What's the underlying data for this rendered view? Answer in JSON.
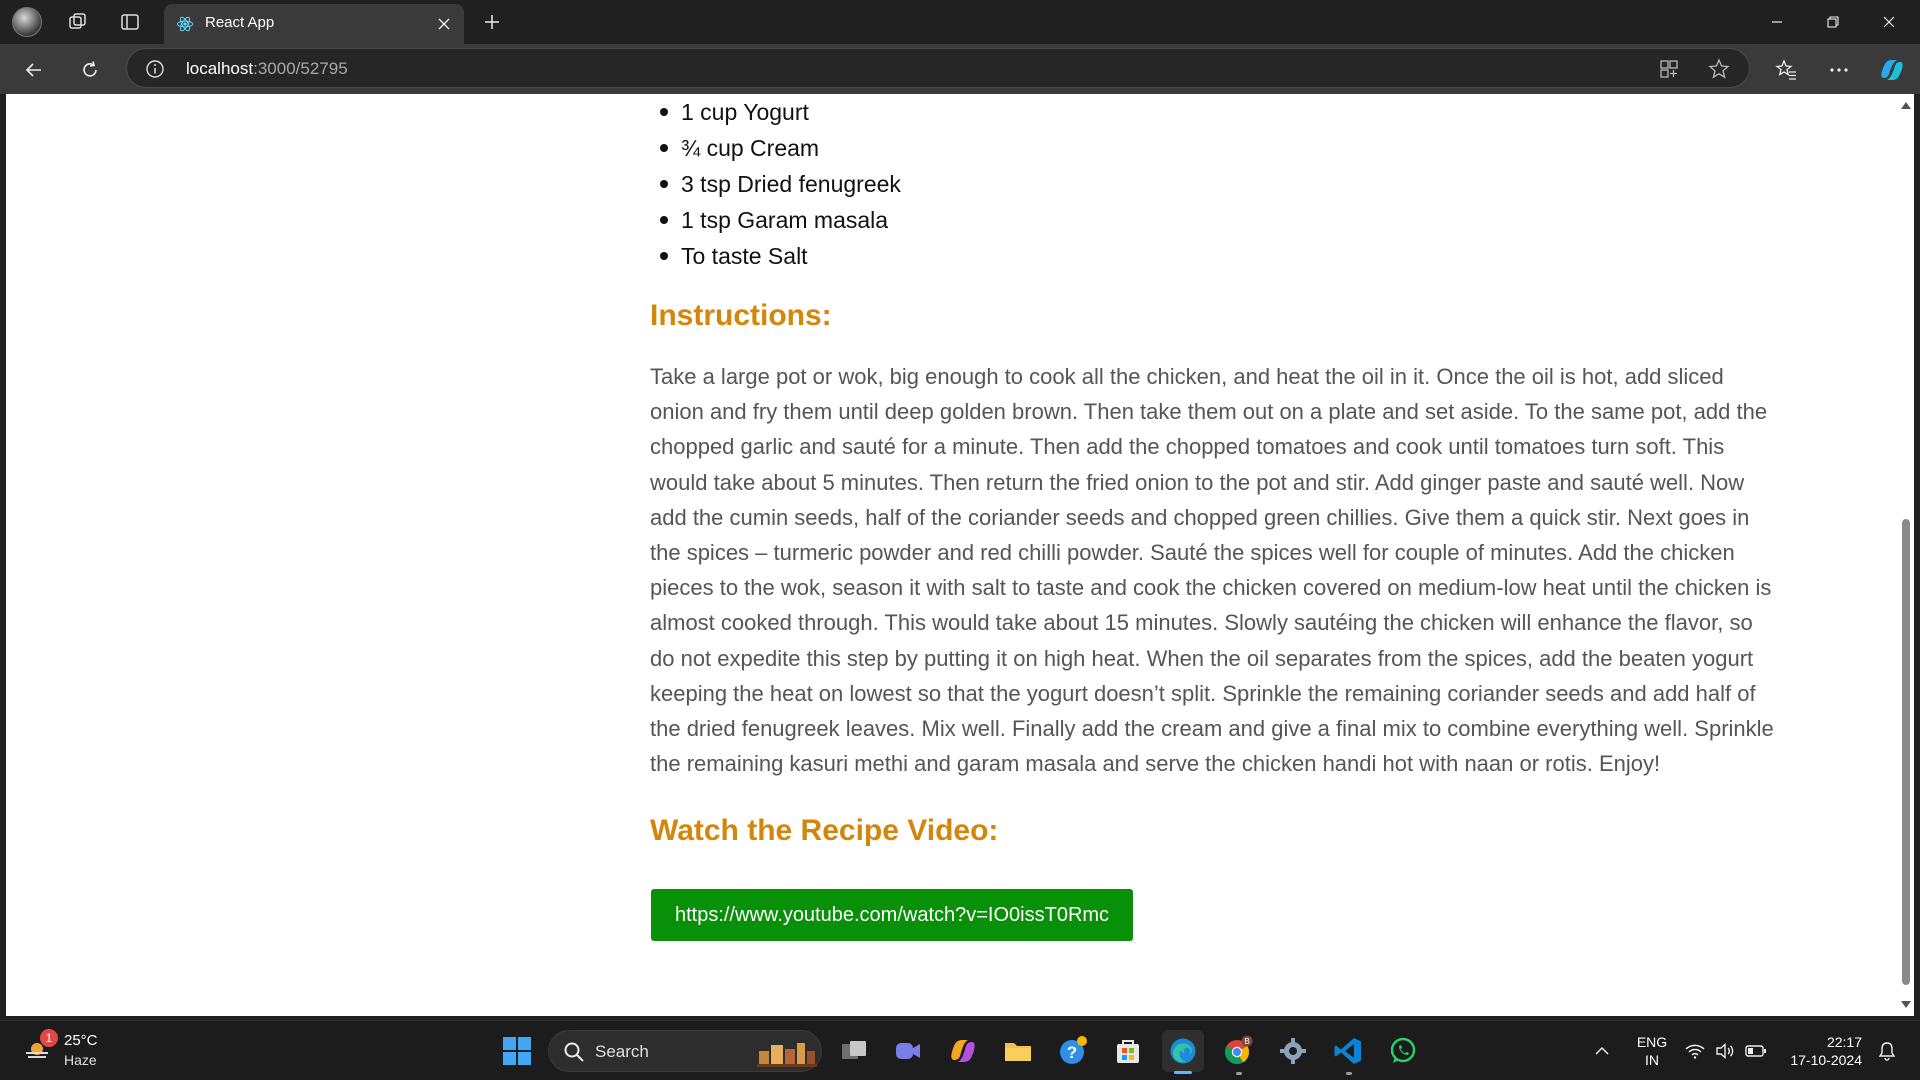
{
  "browser": {
    "tab": {
      "title": "React App"
    },
    "address": {
      "host": "localhost",
      "path": ":3000/52795"
    }
  },
  "page": {
    "ingredients": [
      "1 cup Yogurt",
      "¾ cup Cream",
      "3 tsp Dried fenugreek",
      "1 tsp Garam masala",
      "To taste Salt"
    ],
    "instructions_heading": "Instructions:",
    "instructions_text": "Take a large pot or wok, big enough to cook all the chicken, and heat the oil in it. Once the oil is hot, add sliced onion and fry them until deep golden brown. Then take them out on a plate and set aside. To the same pot, add the chopped garlic and sauté for a minute. Then add the chopped tomatoes and cook until tomatoes turn soft. This would take about 5 minutes. Then return the fried onion to the pot and stir. Add ginger paste and sauté well. Now add the cumin seeds, half of the coriander seeds and chopped green chillies. Give them a quick stir. Next goes in the spices – turmeric powder and red chilli powder. Sauté the spices well for couple of minutes. Add the chicken pieces to the wok, season it with salt to taste and cook the chicken covered on medium-low heat until the chicken is almost cooked through. This would take about 15 minutes. Slowly sautéing the chicken will enhance the flavor, so do not expedite this step by putting it on high heat. When the oil separates from the spices, add the beaten yogurt keeping the heat on lowest so that the yogurt doesn’t split. Sprinkle the remaining coriander seeds and add half of the dried fenugreek leaves. Mix well. Finally add the cream and give a final mix to combine everything well. Sprinkle the remaining kasuri methi and garam masala and serve the chicken handi hot with naan or rotis. Enjoy!",
    "video_heading": "Watch the Recipe Video:",
    "video_link": "https://www.youtube.com/watch?v=IO0issT0Rmc"
  },
  "taskbar": {
    "weather": {
      "badge": "1",
      "temp": "25°C",
      "desc": "Haze"
    },
    "search_label": "Search",
    "lang": {
      "line1": "ENG",
      "line2": "IN"
    },
    "clock": {
      "time": "22:17",
      "date": "17-10-2024"
    },
    "chrome_badge": "B"
  },
  "colors": {
    "heading": "#d4860b",
    "button": "#089008",
    "body_text": "#555555"
  }
}
